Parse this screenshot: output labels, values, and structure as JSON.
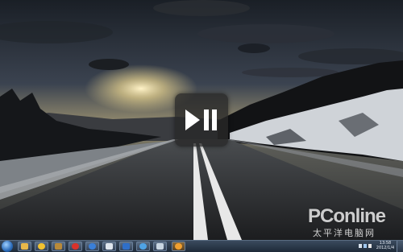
{
  "overlay": {
    "icon": "play-pause-icon"
  },
  "watermark": {
    "brand": "PConline",
    "subtitle": "太平洋电脑网"
  },
  "taskbar": {
    "start_icon": "windows-start-icon",
    "items": [
      {
        "icon": "explorer-folder-icon",
        "color": "#e8b84a"
      },
      {
        "icon": "media-player-icon",
        "color": "#f2c230"
      },
      {
        "icon": "photo-folder-icon",
        "color": "#b88a3a"
      },
      {
        "icon": "red-app-icon",
        "color": "#d8322a"
      },
      {
        "icon": "blue-globe-icon",
        "color": "#3a7fd8"
      },
      {
        "icon": "network-icon",
        "color": "#dfe6ee"
      },
      {
        "icon": "blue-square-app-icon",
        "color": "#2f6fc8"
      },
      {
        "icon": "internet-explorer-icon",
        "color": "#4fa3e6"
      },
      {
        "icon": "document-icon",
        "color": "#c9d6e2"
      },
      {
        "icon": "qq-penguin-icon",
        "color": "#f0a030"
      }
    ],
    "clock": {
      "time": "13:58",
      "date": "2012/1/4"
    }
  }
}
